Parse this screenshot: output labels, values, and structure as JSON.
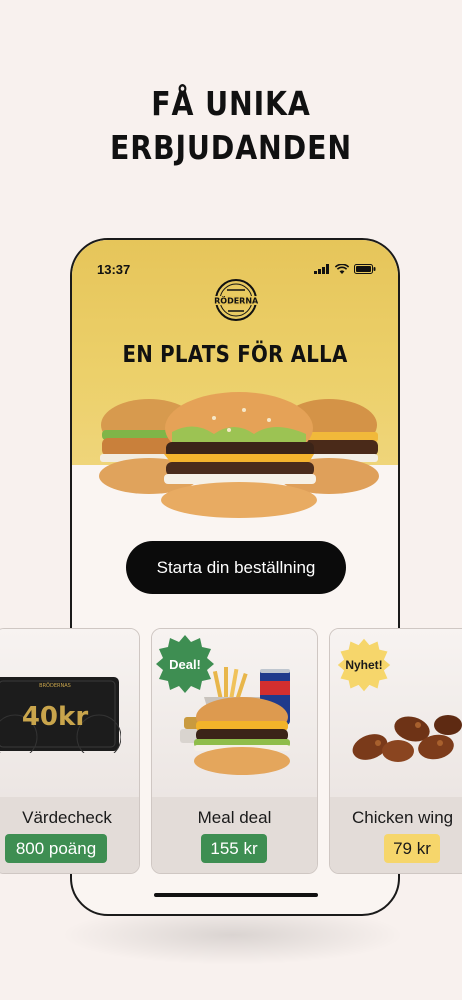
{
  "headline": {
    "line1": "FÅ UNIKA",
    "line2": "ERBJUDANDEN"
  },
  "phone": {
    "time": "13:37",
    "brand": "BRÖDERNAS",
    "tagline": "EN PLATS FÖR ALLA",
    "cta_label": "Starta din beställning"
  },
  "cards": [
    {
      "title": "Värdecheck",
      "price": "800 poäng",
      "voucher_text": "40kr",
      "voucher_brand": "BRÖDERNAS"
    },
    {
      "title": "Meal deal",
      "price": "155 kr",
      "badge": "Deal!"
    },
    {
      "title": "Chicken wing",
      "price": "79 kr",
      "badge": "Nyhet!"
    }
  ],
  "colors": {
    "gold": "#e6c55a",
    "green": "#3e8e52",
    "yellow": "#f6d66b",
    "dark": "#0b0b0b"
  }
}
